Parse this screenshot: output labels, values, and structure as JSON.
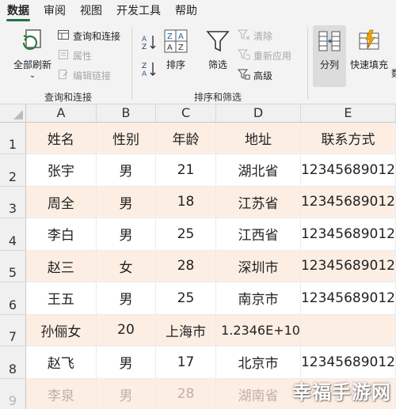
{
  "ribbon_tabs": [
    "数据",
    "审阅",
    "视图",
    "开发工具",
    "帮助"
  ],
  "ribbon": {
    "refresh_all": "全部刷新",
    "queries_connections": "查询和连接",
    "properties": "属性",
    "edit_links": "编辑链接",
    "group_queries": "查询和连接",
    "sort": "排序",
    "filter": "筛选",
    "clear": "清除",
    "reapply": "重新应用",
    "advanced": "高级",
    "group_sort_filter": "排序和筛选",
    "text_to_columns": "分列",
    "flash_fill": "快速填充",
    "group_data_tools_partial": "数"
  },
  "grid": {
    "columns": [
      "A",
      "B",
      "C",
      "D",
      "E"
    ],
    "rows": [
      {
        "num": "1",
        "cells": [
          "姓名",
          "性别",
          "年龄",
          "地址",
          "联系方式"
        ]
      },
      {
        "num": "2",
        "cells": [
          "张宇",
          "男",
          "21",
          "湖北省",
          "12345689012"
        ]
      },
      {
        "num": "3",
        "cells": [
          "周全",
          "男",
          "18",
          "江苏省",
          "12345689012"
        ]
      },
      {
        "num": "4",
        "cells": [
          "李白",
          "男",
          "25",
          "江西省",
          "12345689012"
        ]
      },
      {
        "num": "5",
        "cells": [
          "赵三",
          "女",
          "28",
          "深圳市",
          "12345689012"
        ]
      },
      {
        "num": "6",
        "cells": [
          "王五",
          "男",
          "25",
          "南京市",
          "12345689012"
        ]
      },
      {
        "num": "7",
        "cells": [
          "孙俪女",
          "20",
          "上海市",
          "1.2346E+10",
          ""
        ]
      },
      {
        "num": "8",
        "cells": [
          "赵飞",
          "男",
          "17",
          "北京市",
          "12345689012"
        ]
      },
      {
        "num": "9",
        "cells": [
          "李泉",
          "男",
          "28",
          "湖南省",
          ""
        ]
      }
    ]
  },
  "watermark": "幸福手游网",
  "colors": {
    "accent": "#1e7145",
    "band": "#fdeee4",
    "ribbon_bg": "#f3f3f3"
  }
}
